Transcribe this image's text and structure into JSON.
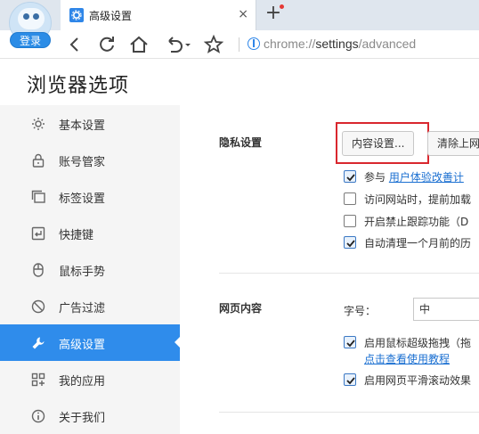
{
  "browser": {
    "login_label": "登录",
    "tab_title": "高级设置",
    "tab_close": "×",
    "new_tab": "+",
    "url_prefix": "chrome://",
    "url_settings": "settings",
    "url_suffix": "/advanced",
    "accent_color": "#2f8ceb"
  },
  "page": {
    "title": "浏览器选项"
  },
  "sidebar": {
    "items": [
      {
        "label": "基本设置",
        "icon": "gear-icon"
      },
      {
        "label": "账号管家",
        "icon": "lock-icon"
      },
      {
        "label": "标签设置",
        "icon": "tabs-icon"
      },
      {
        "label": "快捷键",
        "icon": "shortcut-key-icon"
      },
      {
        "label": "鼠标手势",
        "icon": "mouse-icon"
      },
      {
        "label": "广告过滤",
        "icon": "block-icon"
      },
      {
        "label": "高级设置",
        "icon": "wrench-icon",
        "active": true
      },
      {
        "label": "我的应用",
        "icon": "apps-grid-icon"
      },
      {
        "label": "关于我们",
        "icon": "info-icon"
      }
    ]
  },
  "privacy": {
    "section_label": "隐私设置",
    "content_settings_button": "内容设置...",
    "clear_data_button": "清除上网",
    "options": [
      {
        "prefix": "参与 ",
        "link": "用户体验改善计",
        "checked": true
      },
      {
        "text": "访问网站时，提前加载",
        "checked": false
      },
      {
        "text": "开启禁止跟踪功能（D",
        "checked": false
      },
      {
        "text": "自动清理一个月前的历",
        "checked": true
      }
    ]
  },
  "web_content": {
    "section_label": "网页内容",
    "font_size_label": "字号：",
    "font_size_value": "中",
    "options": [
      {
        "text": "启用鼠标超级拖拽（拖",
        "checked": true,
        "link": "点击查看使用教程"
      },
      {
        "text": "启用网页平滑滚动效果",
        "checked": true
      }
    ]
  }
}
